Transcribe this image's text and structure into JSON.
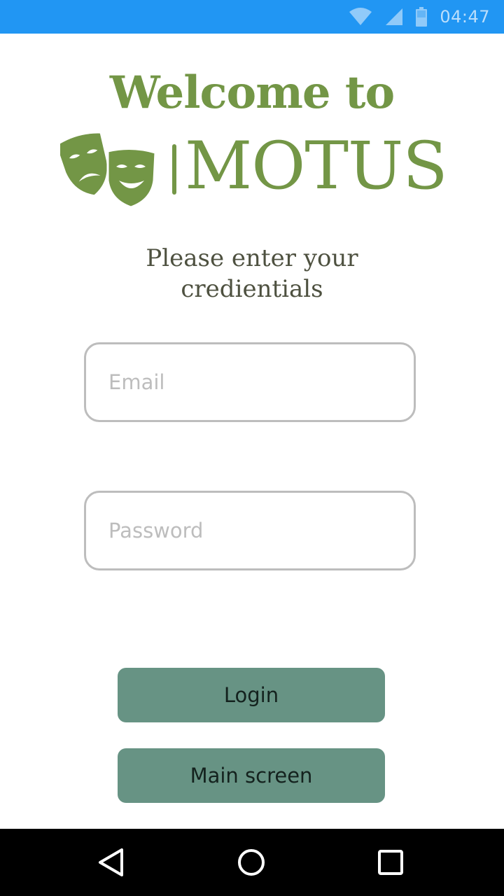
{
  "status_bar": {
    "time": "04:47",
    "icons": [
      "wifi-icon",
      "signal-icon",
      "battery-icon"
    ],
    "background": "#2196f3"
  },
  "header": {
    "welcome": "Welcome to",
    "brand": "MOTUS",
    "logo_icon": "theater-masks-icon",
    "brand_color": "#739646"
  },
  "subtitle": {
    "line1": "Please enter your",
    "line2": "credientials"
  },
  "form": {
    "email": {
      "value": "",
      "placeholder": "Email"
    },
    "password": {
      "value": "",
      "placeholder": "Password"
    }
  },
  "buttons": {
    "login_label": "Login",
    "main_screen_label": "Main screen",
    "color": "#679384"
  },
  "nav_bar": {
    "icons": [
      "back-triangle-icon",
      "home-circle-icon",
      "recent-apps-square-icon"
    ]
  }
}
